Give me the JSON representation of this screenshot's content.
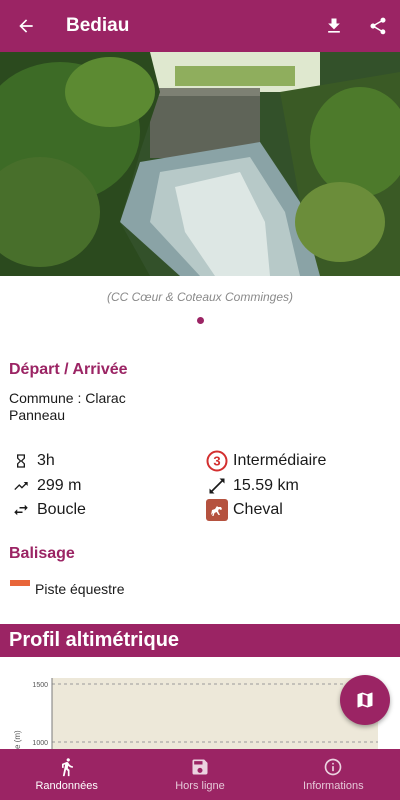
{
  "header": {
    "title": "Bediau",
    "back_icon": "arrow-left-icon",
    "download_icon": "download-icon",
    "share_icon": "share-icon"
  },
  "photo": {
    "credit": "(CC Cœur & Coteaux Comminges)",
    "pages": 1,
    "current_page": 1
  },
  "departure": {
    "title": "Départ / Arrivée",
    "commune": "Commune : Clarac",
    "place": "Panneau"
  },
  "stats": {
    "duration": "3h",
    "difficulty_level": "3",
    "difficulty": "Intermédiaire",
    "elevation": "299 m",
    "distance": "15.59 km",
    "route_type": "Boucle",
    "practice": "Cheval"
  },
  "marking": {
    "title": "Balisage",
    "label": "Piste équestre",
    "color": "#e8663a"
  },
  "profile": {
    "title": "Profil altimétrique",
    "tick_1500": "1500",
    "tick_1000": "1000",
    "axis_label": "e (m)"
  },
  "fab": {
    "icon": "map-icon"
  },
  "bottom_nav": [
    {
      "label": "Randonnées",
      "icon": "hiker-icon",
      "active": true
    },
    {
      "label": "Hors ligne",
      "icon": "save-icon",
      "active": false
    },
    {
      "label": "Informations",
      "icon": "info-icon",
      "active": false
    }
  ],
  "colors": {
    "primary": "#9b2464",
    "marker": "#e8663a",
    "chart_fill": "#ede8d9"
  }
}
